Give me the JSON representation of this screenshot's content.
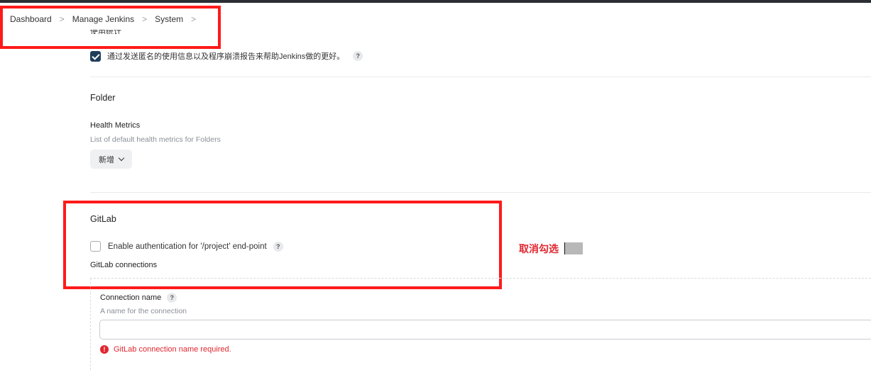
{
  "breadcrumb": {
    "items": [
      "Dashboard",
      "Manage Jenkins",
      "System"
    ],
    "separator": ">"
  },
  "usage_stats": {
    "section_title_cut": "使用统计",
    "checkbox_label": "通过发送匿名的使用信息以及程序崩溃报告来帮助Jenkins做的更好。",
    "checked": true
  },
  "folder": {
    "title": "Folder",
    "health_metrics_label": "Health Metrics",
    "health_metrics_desc": "List of default health metrics for Folders",
    "add_button": "新增"
  },
  "gitlab": {
    "title": "GitLab",
    "auth_checkbox_label": "Enable authentication for '/project' end-point",
    "auth_checked": false,
    "connections_label": "GitLab connections",
    "connection_name_label": "Connection name",
    "connection_name_desc": "A name for the connection",
    "connection_name_value": "",
    "error": "GitLab connection name required."
  },
  "annotation": {
    "text": "取消勾选"
  },
  "help_glyph": "?",
  "error_glyph": "!",
  "colors": {
    "highlight_border": "#ff1a1a",
    "error": "#e0262f",
    "checkbox_checked": "#1f3d5a"
  }
}
